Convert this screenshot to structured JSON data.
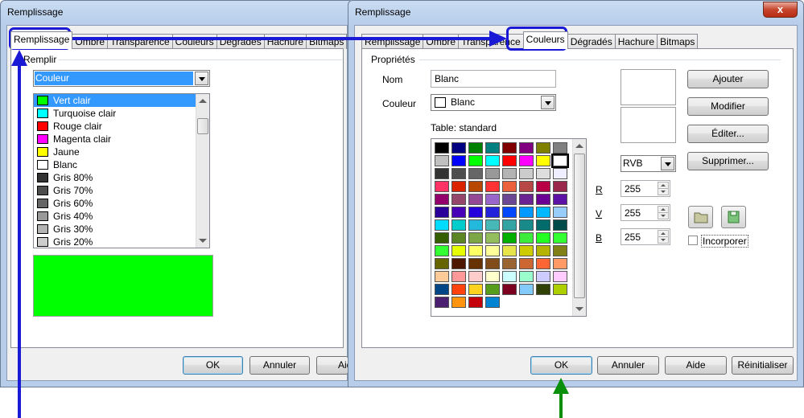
{
  "left_dialog": {
    "title": "Remplissage",
    "tabs": [
      "Remplissage",
      "Ombre",
      "Transparence",
      "Couleurs",
      "Dégradés",
      "Hachure",
      "Bitmaps"
    ],
    "active_tab": "Remplissage",
    "group_label": "Remplir",
    "fill_type": "Couleur",
    "color_list": [
      {
        "name": "Vert clair",
        "color": "#00ff00"
      },
      {
        "name": "Turquoise clair",
        "color": "#00ffff"
      },
      {
        "name": "Rouge clair",
        "color": "#ff0000"
      },
      {
        "name": "Magenta clair",
        "color": "#ff00ff"
      },
      {
        "name": "Jaune",
        "color": "#ffff00"
      },
      {
        "name": "Blanc",
        "color": "#ffffff"
      },
      {
        "name": "Gris 80%",
        "color": "#333333"
      },
      {
        "name": "Gris 70%",
        "color": "#4d4d4d"
      },
      {
        "name": "Gris 60%",
        "color": "#666666"
      },
      {
        "name": "Gris 40%",
        "color": "#999999"
      },
      {
        "name": "Gris 30%",
        "color": "#b3b3b3"
      },
      {
        "name": "Gris 20%",
        "color": "#cccccc"
      }
    ],
    "selected_color": "Vert clair",
    "preview_color": "#00ff00",
    "buttons": {
      "ok": "OK",
      "cancel": "Annuler",
      "help": "Aide"
    }
  },
  "right_dialog": {
    "title": "Remplissage",
    "close_label": "x",
    "tabs": [
      "Remplissage",
      "Ombre",
      "Transparence",
      "Couleurs",
      "Dégradés",
      "Hachure",
      "Bitmaps"
    ],
    "active_tab": "Couleurs",
    "group_label": "Propriétés",
    "name_label": "Nom",
    "name_value": "Blanc",
    "color_label": "Couleur",
    "color_value": "Blanc",
    "table_label": "Table: standard",
    "palette": [
      "#000000",
      "#000080",
      "#008000",
      "#008080",
      "#800000",
      "#800080",
      "#808000",
      "#808080",
      "#c0c0c0",
      "#0000ff",
      "#00ff00",
      "#00ffff",
      "#ff0000",
      "#ff00ff",
      "#ffff00",
      "#ffffff",
      "#333333",
      "#4d4d4d",
      "#666666",
      "#999999",
      "#b3b3b3",
      "#cccccc",
      "#dddddd",
      "#eeeeff",
      "#ff3366",
      "#dc2300",
      "#b84700",
      "#ff3333",
      "#eb613d",
      "#b84747",
      "#b80047",
      "#99284c",
      "#94006b",
      "#94476b",
      "#944794",
      "#9966cc",
      "#6b4794",
      "#6b2394",
      "#6b0094",
      "#5e11a6",
      "#280099",
      "#4700b8",
      "#2300dc",
      "#2323dc",
      "#0047ff",
      "#0099ff",
      "#00b8ff",
      "#99ccff",
      "#00dcff",
      "#00cccc",
      "#23b8dc",
      "#47b8b8",
      "#33a3a3",
      "#198a8a",
      "#006b6b",
      "#004a4a",
      "#355e00",
      "#5c8526",
      "#7da647",
      "#94bd5e",
      "#00ae00",
      "#3deb3d",
      "#23ff23",
      "#33ff33",
      "#33ff33",
      "#e6ff00",
      "#ffff66",
      "#ffff99",
      "#e6e64c",
      "#cccc00",
      "#b3b300",
      "#808019",
      "#666600",
      "#4c1900",
      "#663300",
      "#804c19",
      "#996633",
      "#cc6633",
      "#ff6633",
      "#ff9966",
      "#ffcc99",
      "#ff9999",
      "#ffcccc",
      "#ffffcc",
      "#ccffff",
      "#99ffcc",
      "#ccccff",
      "#ffccff",
      "#004586",
      "#ff420e",
      "#ffd320",
      "#579d1c",
      "#7e0021",
      "#83caff",
      "#314004",
      "#aecf00",
      "#4b1f6f",
      "#ff950e",
      "#c5000b",
      "#0084d1"
    ],
    "selected_swatch": 15,
    "model": "RVB",
    "channels": [
      {
        "label": "R",
        "value": "255"
      },
      {
        "label": "V",
        "value": "255"
      },
      {
        "label": "B",
        "value": "255"
      }
    ],
    "side_buttons": {
      "add": "Ajouter",
      "modify": "Modifier",
      "edit": "Éditer...",
      "delete": "Supprimer..."
    },
    "embed_label": "Incorporer",
    "buttons": {
      "ok": "OK",
      "cancel": "Annuler",
      "help": "Aide",
      "reset": "Réinitialiser"
    }
  }
}
